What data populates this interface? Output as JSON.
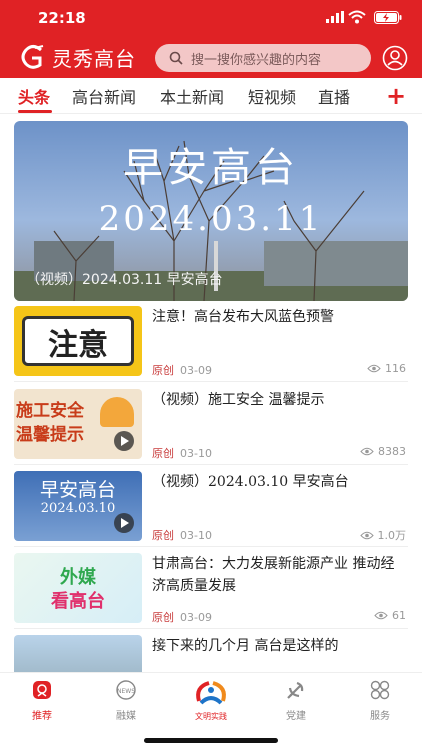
{
  "status_bar": {
    "time": "22:18"
  },
  "app": {
    "name": "灵秀高台"
  },
  "search": {
    "placeholder": "搜一搜你感兴趣的内容"
  },
  "tabs": [
    {
      "label": "头条",
      "active": true
    },
    {
      "label": "高台新闻"
    },
    {
      "label": "本土新闻"
    },
    {
      "label": "短视频"
    },
    {
      "label": "直播"
    },
    {
      "label": "+"
    }
  ],
  "banner": {
    "title": "早安高台",
    "date": "2024.03.11",
    "caption": "（视频）2024.03.11 早安高台"
  },
  "articles": [
    {
      "title": "注意！高台发布大风蓝色预警",
      "tag": "原创",
      "date": "03-09",
      "views": "116",
      "thumb_text": "注意",
      "thumb_type": "notice"
    },
    {
      "title": "（视频）施工安全 温馨提示",
      "tag": "原创",
      "date": "03-10",
      "views": "8383",
      "thumb_lines": [
        "施工安全",
        "温馨提示"
      ],
      "thumb_type": "video"
    },
    {
      "title": "（视频）2024.03.10 早安高台",
      "tag": "原创",
      "date": "03-10",
      "views": "1.0万",
      "thumb_lines": [
        "早安高台",
        "2024.03.10"
      ],
      "thumb_type": "video"
    },
    {
      "title": "甘肃高台：大力发展新能源产业 推动经济高质量发展",
      "tag": "原创",
      "date": "03-09",
      "views": "61",
      "thumb_lines": [
        "外媒",
        "看高台"
      ],
      "thumb_type": "media"
    },
    {
      "title": "接下来的几个月 高台是这样的",
      "thumb_type": "photo"
    }
  ],
  "bottom_nav": [
    {
      "label": "推荐",
      "icon": "recommend-icon",
      "active": true
    },
    {
      "label": "融媒",
      "icon": "news-icon"
    },
    {
      "label": "文明实践",
      "icon": "civilization-logo-icon"
    },
    {
      "label": "党建",
      "icon": "party-icon"
    },
    {
      "label": "服务",
      "icon": "services-icon"
    }
  ],
  "colors": {
    "brand_red": "#e02225",
    "meta_gray": "#999999",
    "tag_red": "#c83c3c"
  }
}
